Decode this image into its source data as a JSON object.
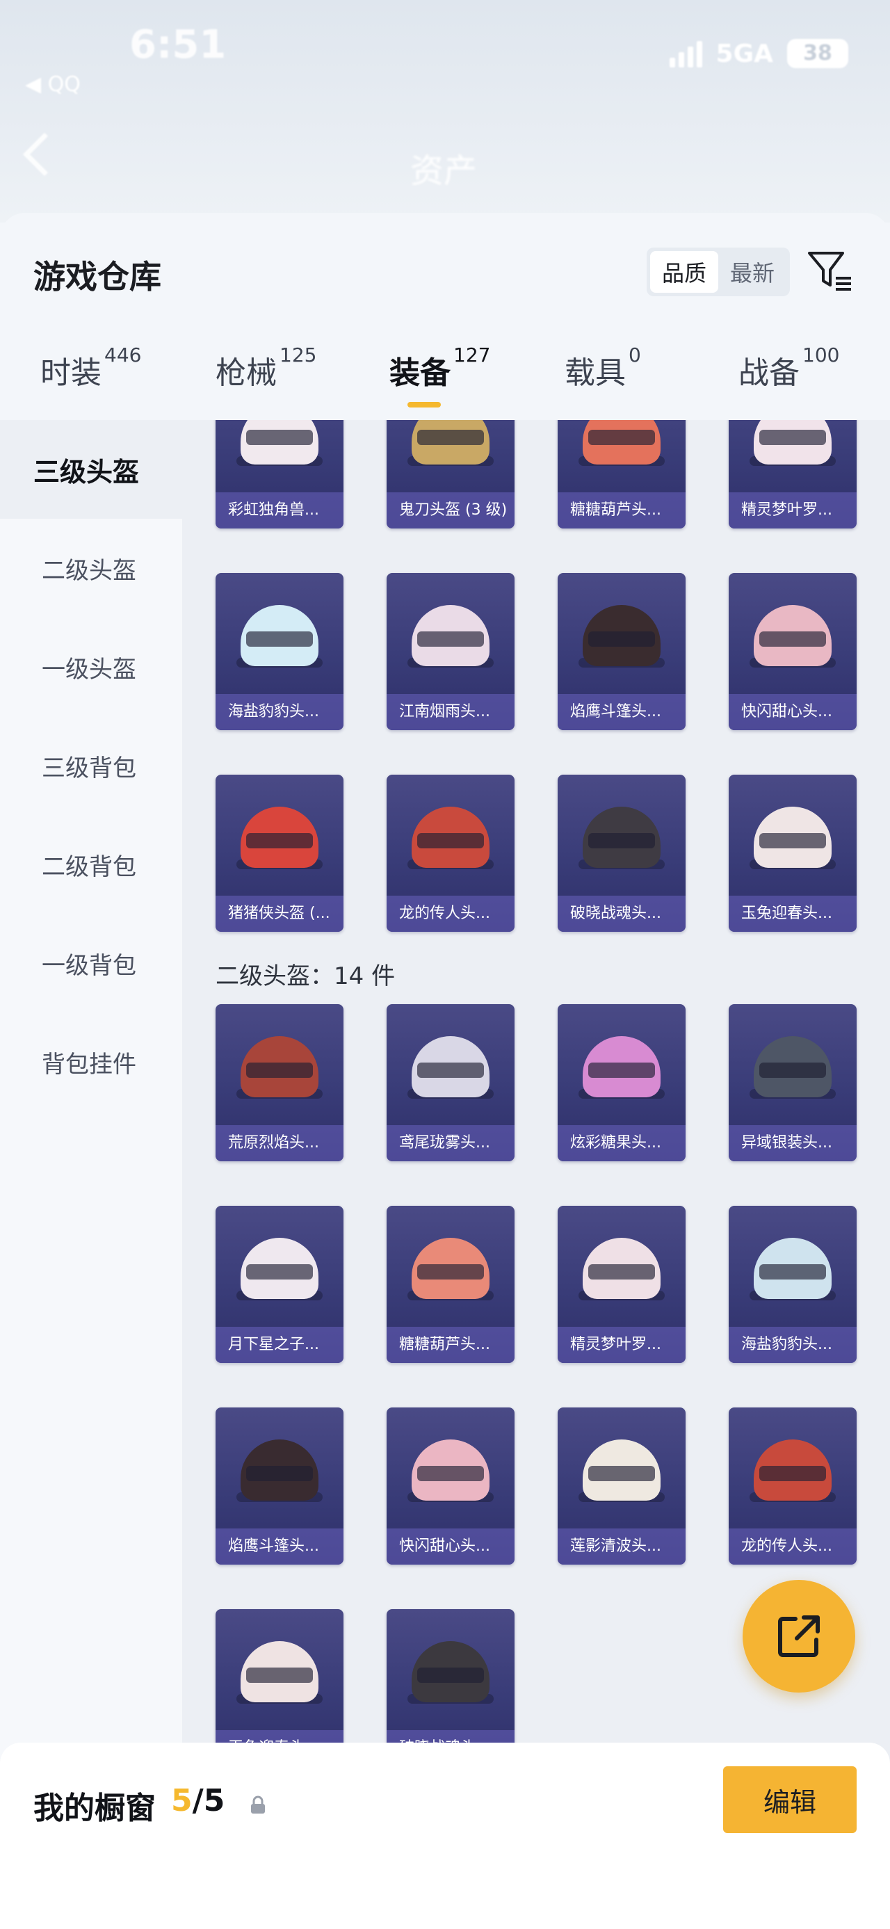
{
  "status": {
    "time": "6:51",
    "network": "5GA",
    "battery": "38",
    "back_app": "◀ QQ"
  },
  "header": {
    "title": "资产"
  },
  "sheet": {
    "title": "游戏仓库",
    "sort_options": [
      "品质",
      "最新"
    ],
    "active_sort": "品质"
  },
  "tabs": [
    {
      "label": "时装",
      "count": "446"
    },
    {
      "label": "枪械",
      "count": "125"
    },
    {
      "label": "装备",
      "count": "127"
    },
    {
      "label": "载具",
      "count": "0"
    },
    {
      "label": "战备",
      "count": "100"
    }
  ],
  "side_menu": [
    "三级头盔",
    "二级头盔",
    "一级头盔",
    "三级背包",
    "二级背包",
    "一级背包",
    "背包挂件"
  ],
  "level3_items": [
    {
      "name": "彩虹独角兽...",
      "color": "#f1e9ee"
    },
    {
      "name": "鬼刀头盔 (3 级)",
      "color": "#c9a865"
    },
    {
      "name": "糖糖葫芦头...",
      "color": "#e4725c"
    },
    {
      "name": "精灵梦叶罗...",
      "color": "#f1e3ea"
    },
    {
      "name": "海盐豹豹头...",
      "color": "#d4ecf6"
    },
    {
      "name": "江南烟雨头...",
      "color": "#eadbe7"
    },
    {
      "name": "焰鹰斗篷头...",
      "color": "#3a2c2f"
    },
    {
      "name": "快闪甜心头...",
      "color": "#e9b8c4"
    },
    {
      "name": "猪猪侠头盔 (...",
      "color": "#d9453c"
    },
    {
      "name": "龙的传人头...",
      "color": "#c94a3d"
    },
    {
      "name": "破晓战魂头...",
      "color": "#3f3b43"
    },
    {
      "name": "玉兔迎春头...",
      "color": "#efe5e5"
    }
  ],
  "level2_section": {
    "label": "二级头盔：",
    "count": "14 件"
  },
  "level2_items": [
    {
      "name": "荒原烈焰头...",
      "color": "#a8453a"
    },
    {
      "name": "鸢尾珑雾头...",
      "color": "#d9d7e6"
    },
    {
      "name": "炫彩糖果头...",
      "color": "#d88bd2"
    },
    {
      "name": "异域银装头...",
      "color": "#4e5666"
    },
    {
      "name": "月下星之子...",
      "color": "#efe8ef"
    },
    {
      "name": "糖糖葫芦头...",
      "color": "#e98a78"
    },
    {
      "name": "精灵梦叶罗...",
      "color": "#efe0e6"
    },
    {
      "name": "海盐豹豹头...",
      "color": "#cfe3ee"
    },
    {
      "name": "焰鹰斗篷头...",
      "color": "#392b30"
    },
    {
      "name": "快闪甜心头...",
      "color": "#ebb6c3"
    },
    {
      "name": "莲影清波头...",
      "color": "#efe9e1"
    },
    {
      "name": "龙的传人头...",
      "color": "#c84a3c"
    },
    {
      "name": "玉兔迎春头...",
      "color": "#efe3e3"
    },
    {
      "name": "破晓战魂头...",
      "color": "#3c393f"
    }
  ],
  "showcase": {
    "title": "我的橱窗",
    "used": "5",
    "total": "/5",
    "edit_label": "编辑"
  },
  "colors": {
    "accent": "#f5b433",
    "card_bg": "#3a3c78"
  }
}
